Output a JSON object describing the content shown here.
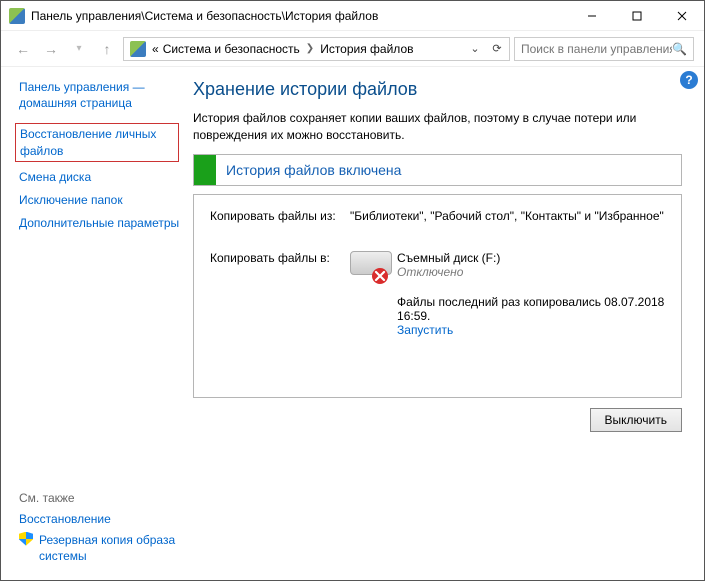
{
  "window": {
    "title": "Панель управления\\Система и безопасность\\История файлов"
  },
  "breadcrumb": {
    "root_prefix": "«",
    "parent": "Система и безопасность",
    "current": "История файлов"
  },
  "search": {
    "placeholder": "Поиск в панели управления"
  },
  "sidebar": {
    "home": "Панель управления — домашняя страница",
    "tasks": [
      "Восстановление личных файлов",
      "Смена диска",
      "Исключение папок",
      "Дополнительные параметры"
    ],
    "see_also_title": "См. также",
    "see_also": [
      "Восстановление",
      "Резервная копия образа системы"
    ]
  },
  "content": {
    "title": "Хранение истории файлов",
    "description": "История файлов сохраняет копии ваших файлов, поэтому в случае потери или повреждения их можно восстановить.",
    "status": "История файлов включена",
    "copy_from_label": "Копировать файлы из:",
    "copy_from_value": "\"Библиотеки\", \"Рабочий стол\", \"Контакты\" и \"Избранное\"",
    "copy_to_label": "Копировать файлы в:",
    "drive_name": "Съемный диск (F:)",
    "drive_status": "Отключено",
    "last_copy": "Файлы последний раз копировались 08.07.2018 16:59.",
    "run_now": "Запустить",
    "disable_button": "Выключить"
  }
}
